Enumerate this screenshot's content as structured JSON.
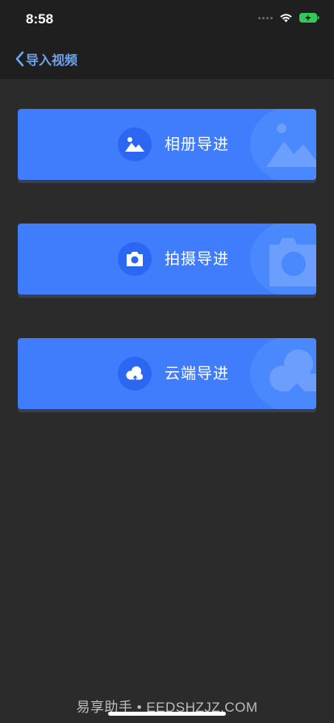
{
  "status_bar": {
    "time": "8:58",
    "battery_color": "#34c759"
  },
  "nav": {
    "back_label": "导入视频",
    "accent": "#6fa2ee"
  },
  "cards": [
    {
      "label": "相册导进",
      "icon": "mountain-photo-icon"
    },
    {
      "label": "拍摄导进",
      "icon": "camera-icon"
    },
    {
      "label": "云端导进",
      "icon": "cloud-upload-icon"
    }
  ],
  "card_color": "#3f7dfc",
  "footer": {
    "watermark": "易享助手 • EEDSHZJZ.COM"
  }
}
